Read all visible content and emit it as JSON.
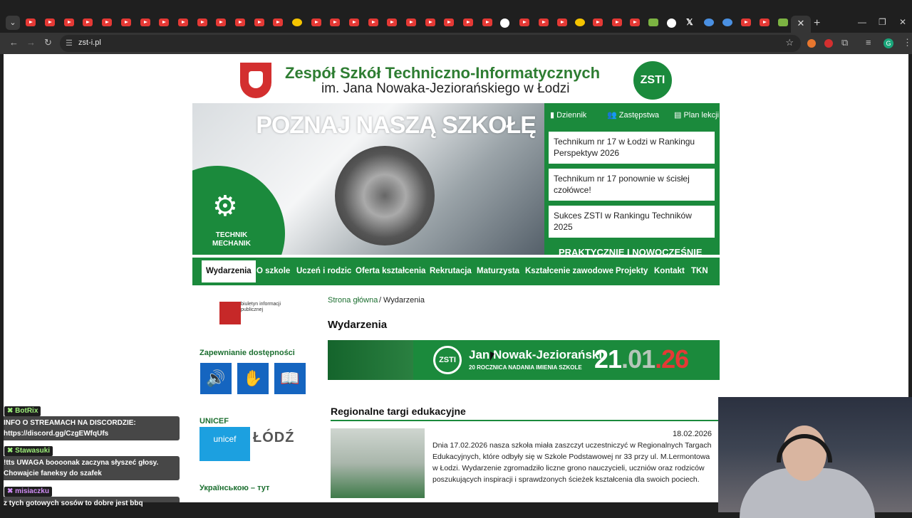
{
  "browser": {
    "url": "zst-i.pl",
    "close_tab": "✕",
    "new_tab": "+",
    "minimize": "—",
    "restore": "❐",
    "close": "✕",
    "extension_label": "G"
  },
  "header": {
    "title_line1": "Zespół Szkół Techniczno-Informatycznych",
    "title_line2": "im. Jana Nowaka-Jeziorańskiego w Łodzi",
    "logo_text": "ZSTI"
  },
  "hero": {
    "title": "POZNAJ NASZĄ SZKOŁĘ",
    "label": "TECHNIK MECHANIK"
  },
  "side_panel": {
    "links": [
      "Dziennik",
      "Zastępstwa",
      "Plan lekcji"
    ],
    "news": [
      "Technikum nr 17 w Łodzi w Rankingu Perspektyw 2026",
      "Technikum nr 17 ponownie w ścisłej czołówce!",
      "Sukces ZSTI w Rankingu Techników 2025"
    ],
    "motto": "PRAKTYCZNIE I NOWOCZEŚNIE"
  },
  "nav": {
    "items": [
      "Wydarzenia",
      "O szkole",
      "Uczeń i rodzic",
      "Oferta kształcenia",
      "Rekrutacja",
      "Maturzysta",
      "Kształcenie zawodowe",
      "Projekty",
      "Kontakt",
      "TKN"
    ]
  },
  "sidebar": {
    "bip_text": "biuletyn informacji publicznej",
    "accessibility_heading": "Zapewnianie dostępności",
    "unicef_heading": "UNICEF",
    "unicef_logo": "unicef",
    "ukrainian_heading": "Українською – тут"
  },
  "breadcrumb": {
    "home": "Strona główna",
    "separator": "/",
    "current": "Wydarzenia"
  },
  "page_title": "Wydarzenia",
  "banner": {
    "logo": "ZSTI",
    "name": "Jan Nowak-Jeziorański",
    "subtitle": "20 ROCZNICA NADANIA IMIENIA SZKOLE",
    "date_day": "21",
    "date_month": "01",
    "date_year": "26"
  },
  "article": {
    "title": "Regionalne targi edukacyjne",
    "date": "18.02.2026",
    "text": "Dnia 17.02.2026 nasza szkoła miała zaszczyt uczestniczyć w Regionalnych Targach Edukacyjnych, które odbyły się w Szkole Podstawowej nr 33 przy ul. M.Lermontowa w Łodzi. Wydarzenie zgromadziło liczne grono nauczycieli, uczniów oraz rodziców poszukujących inspiracji i sprawdzonych ścieżek kształcenia dla swoich pociech."
  },
  "chat": [
    {
      "user": "BotRix",
      "message": "INFO O STREAMACH NA DISCORDZIE: https://discord.gg/CzgEWfqUfs"
    },
    {
      "user": "Stawasuki",
      "message": "!tts UWAGA boooonak zaczyna słyszeć głosy. Chowajcie faneksy do szafek"
    },
    {
      "user": "misiaczku",
      "message": "z tych gotowych sosów to dobre jest bbq"
    }
  ]
}
